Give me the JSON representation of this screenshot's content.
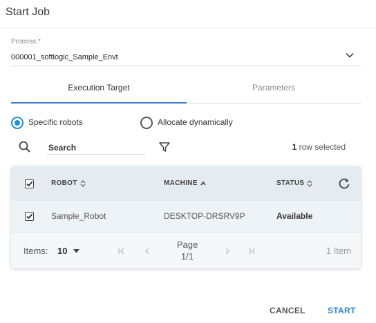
{
  "dialog": {
    "title": "Start Job"
  },
  "process": {
    "label": "Process *",
    "value": "000001_softlogic_Sample_Envt"
  },
  "tabs": [
    {
      "label": "Execution Target",
      "active": true
    },
    {
      "label": "Parameters",
      "active": false
    }
  ],
  "allocation": {
    "options": [
      {
        "label": "Specific robots",
        "checked": true
      },
      {
        "label": "Allocate dynamically",
        "checked": false
      }
    ]
  },
  "search": {
    "placeholder": "Search"
  },
  "selection": {
    "count": "1",
    "suffix": "row selected"
  },
  "table": {
    "headers": [
      "ROBOT",
      "MACHINE",
      "STATUS"
    ],
    "rows": [
      {
        "robot": "Sample_Robot",
        "machine": "DESKTOP-DRSRV9P",
        "status": "Available",
        "checked": true
      }
    ]
  },
  "footer": {
    "items_label": "Items:",
    "items_per_page": "10",
    "page_label": "Page",
    "page_value": "1/1",
    "item_count": "1 Item"
  },
  "actions": {
    "cancel": "CANCEL",
    "start": "START"
  },
  "colors": {
    "accent": "#2f86d1",
    "radio": "#1f8fd6",
    "tab_indicator": "#3b7ec2"
  },
  "icons": [
    "chevron-down-icon",
    "search-icon",
    "filter-icon",
    "sort-icon",
    "refresh-icon",
    "caret-down-icon",
    "first-page-icon",
    "prev-page-icon",
    "next-page-icon",
    "last-page-icon",
    "checkmark-icon"
  ]
}
